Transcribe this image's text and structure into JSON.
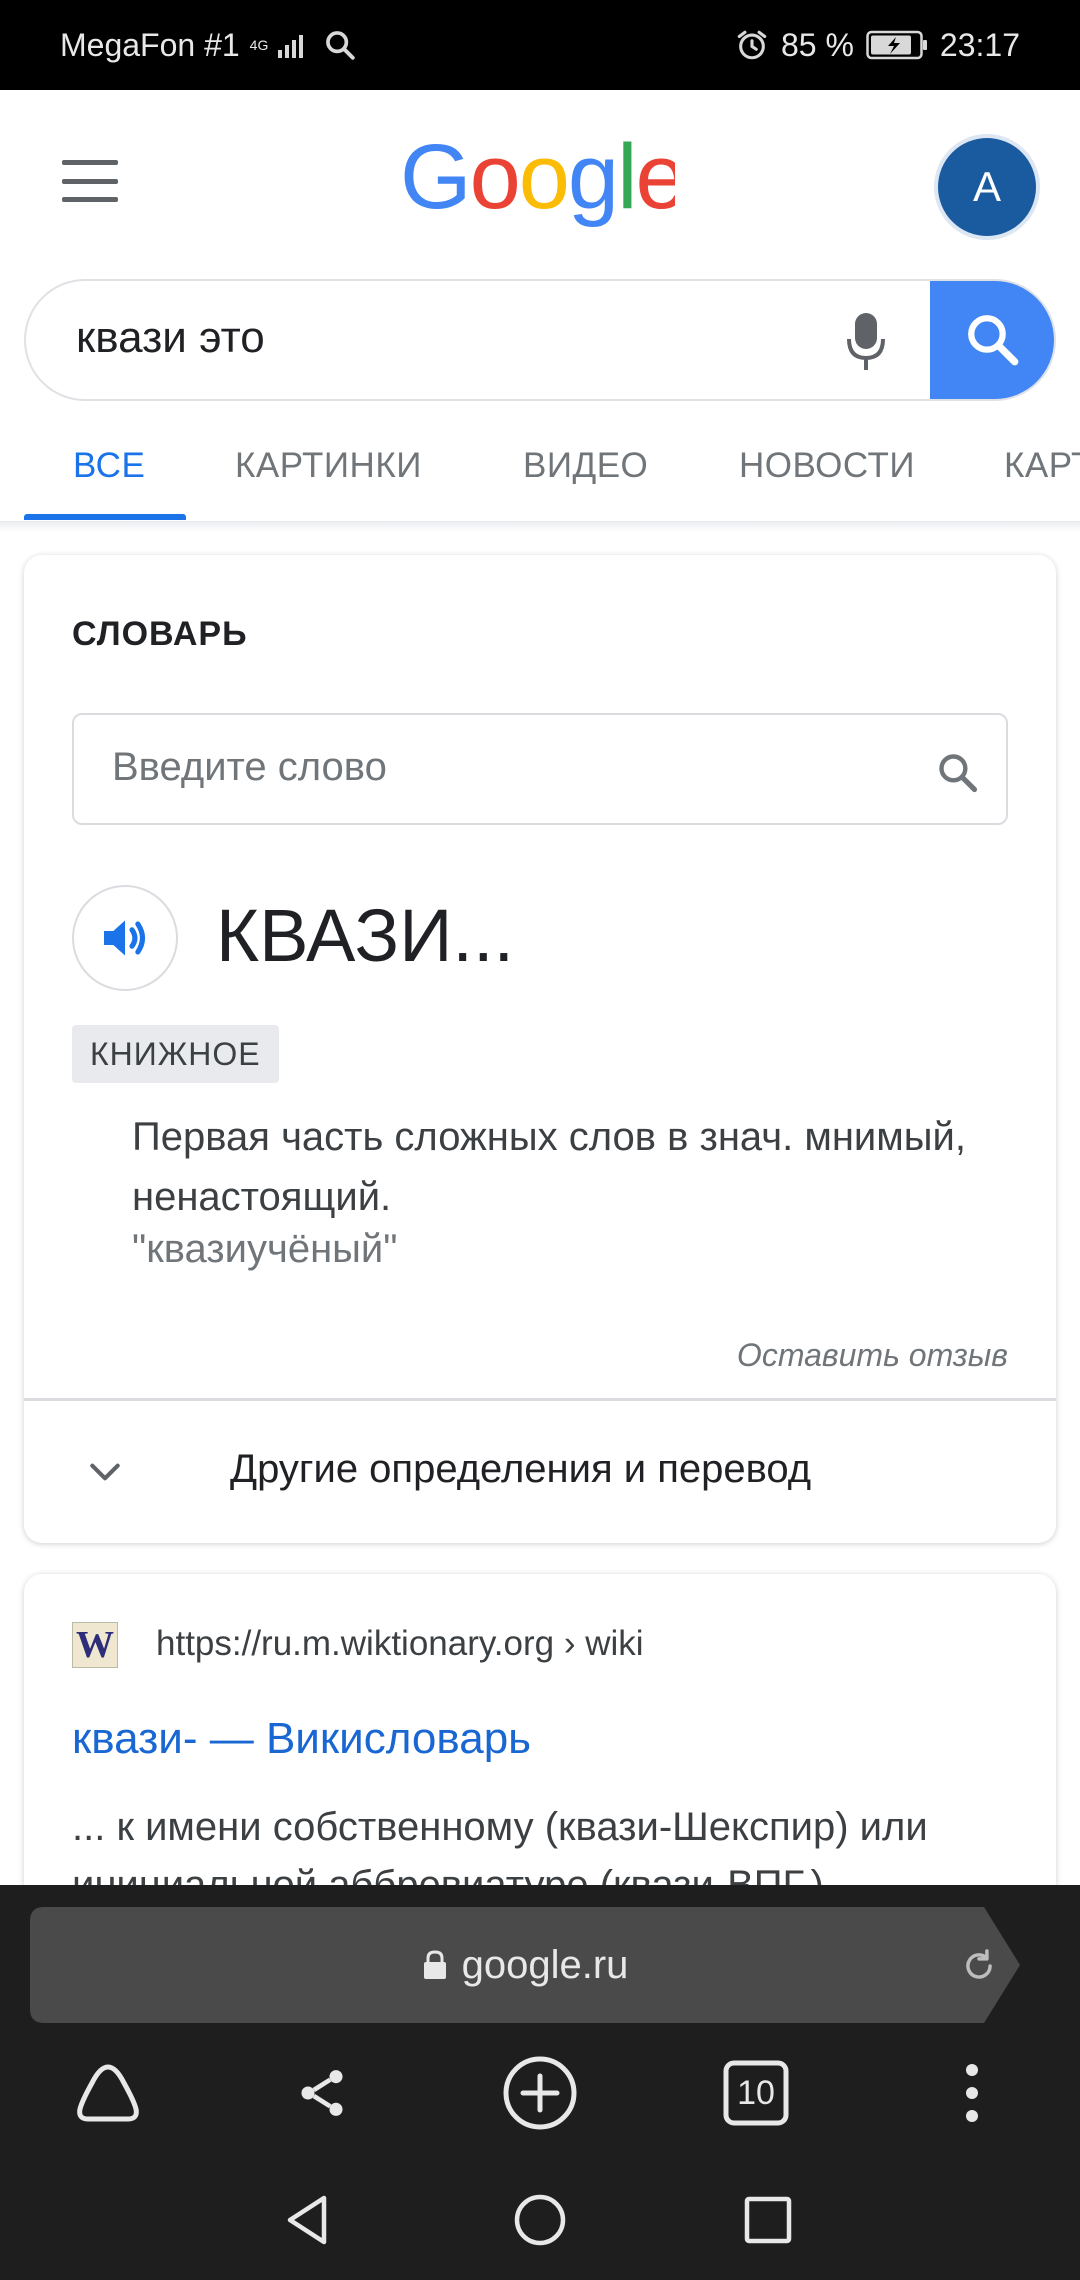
{
  "status_bar": {
    "carrier": "MegaFon #1",
    "network": "4G",
    "battery": "85 %",
    "time": "23:17"
  },
  "header": {
    "logo_text": "Google",
    "avatar_letter": "A",
    "avatar_color": "#1a5a9e"
  },
  "search": {
    "query": "квази это"
  },
  "tabs": [
    {
      "label": "ВСЕ"
    },
    {
      "label": "КАРТИНКИ"
    },
    {
      "label": "ВИДЕО"
    },
    {
      "label": "НОВОСТИ"
    },
    {
      "label": "КАРТЫ"
    }
  ],
  "dictionary": {
    "title": "СЛОВАРЬ",
    "input_placeholder": "Введите слово",
    "word": "КВАЗИ...",
    "register_badge": "КНИЖНОЕ",
    "definition": "Первая часть сложных слов в знач. мнимый, ненастоящий.",
    "example": "\"квазиучёный\"",
    "feedback": "Оставить отзыв",
    "more_label": "Другие определения и перевод"
  },
  "result": {
    "favicon_letter": "W",
    "url": "https://ru.m.wiktionary.org › wiki",
    "title": "квази- — Викисловарь",
    "snippet": "... к имени собственному (квази-Шекспир) или инициальной аббревиатуре (квази-ВПГ.)"
  },
  "browser": {
    "address": "google.ru",
    "tab_count": "10"
  },
  "colors": {
    "accent": "#1a73e8",
    "search_button": "#4285f4",
    "link": "#1967d2"
  }
}
